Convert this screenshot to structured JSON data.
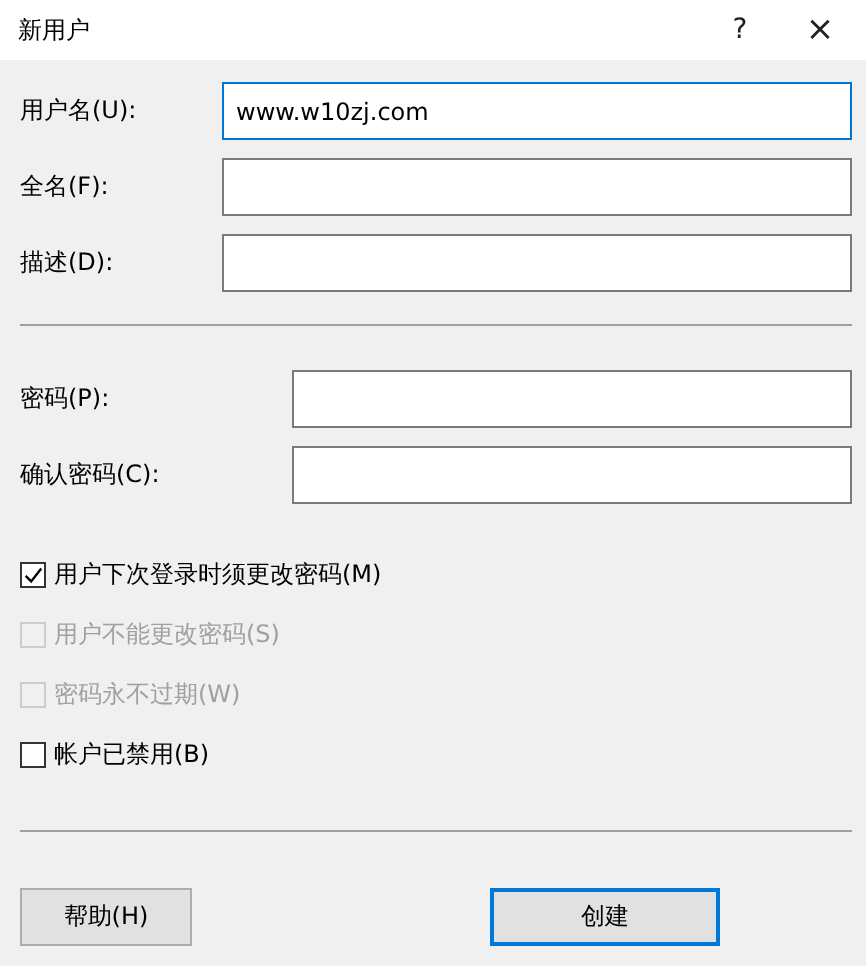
{
  "window": {
    "title": "新用户",
    "help": "?",
    "close": "×"
  },
  "fields": [
    {
      "label": "用户名(U):",
      "value": "www.w10zj.com",
      "focused": true
    },
    {
      "label": "全名(F):",
      "focused": false
    },
    {
      "label": "描述(D):",
      "focused": false
    }
  ],
  "password_fields": [
    {
      "label": "密码(P):"
    },
    {
      "label": "确认密码(C):"
    }
  ],
  "options": [
    {
      "label": "用户下次登录时须更改密码(M)",
      "checked": true,
      "disabled": false
    },
    {
      "label": "用户不能更改密码(S)",
      "checked": false,
      "disabled": true
    },
    {
      "label": "密码永不过期(W)",
      "checked": false,
      "disabled": true
    },
    {
      "label": "帐户已禁用(B)",
      "checked": false,
      "disabled": false
    }
  ],
  "buttons": [
    {
      "label": "帮助(H)",
      "default": false
    },
    {
      "label": "创建",
      "default": true
    }
  ]
}
